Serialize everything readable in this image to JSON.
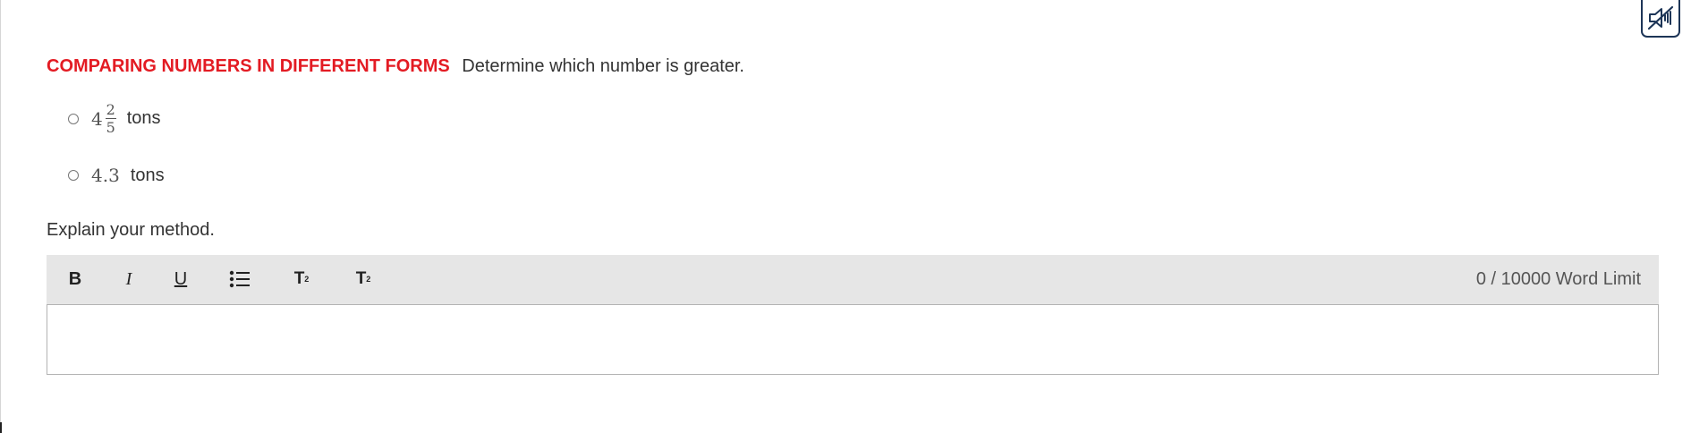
{
  "question": {
    "title": "COMPARING NUMBERS IN DIFFERENT FORMS",
    "prompt": "Determine which number is greater."
  },
  "options": [
    {
      "whole": "4",
      "numerator": "2",
      "denominator": "5",
      "unit": "tons"
    },
    {
      "value": "4.3",
      "unit": "tons"
    }
  ],
  "explain_label": "Explain your method.",
  "toolbar": {
    "bold": "B",
    "italic": "I",
    "underline": "U",
    "superscript": "T",
    "superscript_mark": "2",
    "subscript": "T",
    "subscript_mark": "2",
    "word_count": "0 / 10000 Word Limit"
  },
  "editor": {
    "value": ""
  },
  "icons": {
    "mute": "speaker-muted-icon",
    "list": "bulleted-list-icon"
  },
  "colors": {
    "title": "#e31b23",
    "toolbar_bg": "#e6e6e6",
    "icon_border": "#1d3557"
  }
}
